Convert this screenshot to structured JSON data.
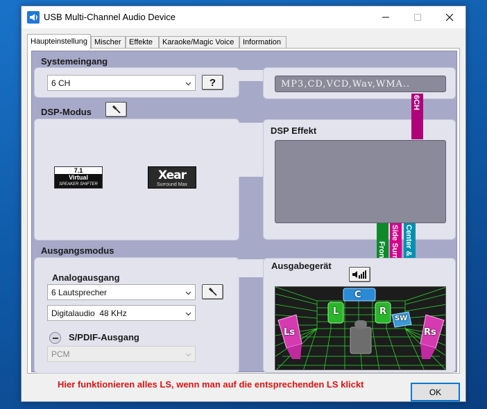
{
  "window": {
    "title": "USB Multi-Channel Audio Device"
  },
  "tabs": [
    {
      "label": "Haupteinstellung",
      "active": true
    },
    {
      "label": "Mischer",
      "active": false
    },
    {
      "label": "Effekte",
      "active": false
    },
    {
      "label": "Karaoke/Magic Voice",
      "active": false
    },
    {
      "label": "Information",
      "active": false
    }
  ],
  "systemeingang": {
    "label": "Systemeingang",
    "selected": "6 CH",
    "help_label": "?",
    "source_display": "MP3,CD,VCD,Wav,WMA.."
  },
  "dsp_modus": {
    "label": "DSP-Modus",
    "virtual_71": {
      "top": "7.1",
      "middle": "Virtual",
      "bottom": "SPEAKER SHIFTER"
    },
    "xear": {
      "main": "Xear",
      "sub": "Surround Max"
    }
  },
  "dsp_effekt": {
    "label": "DSP Effekt"
  },
  "signal_bars": [
    {
      "label": "6CH",
      "color": "#b0007a"
    },
    {
      "label": "Front",
      "color": "#0e8a2a"
    },
    {
      "label": "Side Surround",
      "color": "#d6008a"
    },
    {
      "label": "Center & Sub",
      "color": "#0090b0"
    }
  ],
  "ausgangsmodus": {
    "label": "Ausgangsmodus",
    "analog_label": "Analogausgang",
    "analog_selected": "6 Lautsprecher",
    "digital_selected": "Digitalaudio  48 KHz",
    "spdif_label": "S/PDIF-Ausgang",
    "spdif_selected": "PCM"
  },
  "ausgabegeraet": {
    "label": "Ausgabegerät",
    "speakers": {
      "center": "C",
      "left": "L",
      "right": "R",
      "subwoofer": "SW",
      "left_surround": "Ls",
      "right_surround": "Rs"
    }
  },
  "footer": {
    "message": "Hier funktionieren alles LS, wenn man auf die entsprechenden LS klickt",
    "ok_label": "OK"
  },
  "colors": {
    "panel_bg": "#a6a9c8",
    "box_bg": "#e3e3ee",
    "footer_text": "#e01010",
    "accent": "#0078d7"
  }
}
